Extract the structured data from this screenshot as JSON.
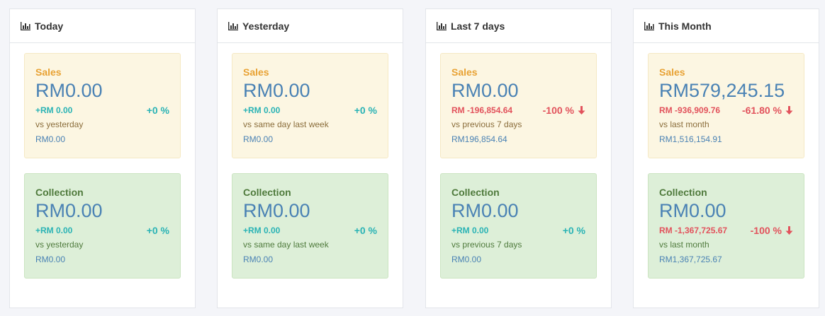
{
  "panels": [
    {
      "title": "Today",
      "sales": {
        "label": "Sales",
        "amount": "RM0.00",
        "diff": "+RM 0.00",
        "pct": "+0 %",
        "trend": "up",
        "vs": "vs yesterday",
        "prev": "RM0.00"
      },
      "collection": {
        "label": "Collection",
        "amount": "RM0.00",
        "diff": "+RM 0.00",
        "pct": "+0 %",
        "trend": "up",
        "vs": "vs yesterday",
        "prev": "RM0.00"
      }
    },
    {
      "title": "Yesterday",
      "sales": {
        "label": "Sales",
        "amount": "RM0.00",
        "diff": "+RM 0.00",
        "pct": "+0 %",
        "trend": "up",
        "vs": "vs same day last week",
        "prev": "RM0.00"
      },
      "collection": {
        "label": "Collection",
        "amount": "RM0.00",
        "diff": "+RM 0.00",
        "pct": "+0 %",
        "trend": "up",
        "vs": "vs same day last week",
        "prev": "RM0.00"
      }
    },
    {
      "title": "Last 7 days",
      "sales": {
        "label": "Sales",
        "amount": "RM0.00",
        "diff": "RM -196,854.64",
        "pct": "-100 %",
        "trend": "down",
        "vs": "vs previous 7 days",
        "prev": "RM196,854.64"
      },
      "collection": {
        "label": "Collection",
        "amount": "RM0.00",
        "diff": "+RM 0.00",
        "pct": "+0 %",
        "trend": "up",
        "vs": "vs previous 7 days",
        "prev": "RM0.00"
      }
    },
    {
      "title": "This Month",
      "sales": {
        "label": "Sales",
        "amount": "RM579,245.15",
        "diff": "RM -936,909.76",
        "pct": "-61.80 %",
        "trend": "down",
        "vs": "vs last month",
        "prev": "RM1,516,154.91"
      },
      "collection": {
        "label": "Collection",
        "amount": "RM0.00",
        "diff": "RM -1,367,725.67",
        "pct": "-100 %",
        "trend": "down",
        "vs": "vs last month",
        "prev": "RM1,367,725.67"
      }
    }
  ],
  "colors": {
    "up": "#2ab3b5",
    "down": "#e2525c",
    "amount": "#4a82b4",
    "sales_bg": "#fcf6e2",
    "collection_bg": "#ddefd8"
  },
  "icons": {
    "header": "bar-chart-icon",
    "trend_down": "arrow-down-icon"
  }
}
